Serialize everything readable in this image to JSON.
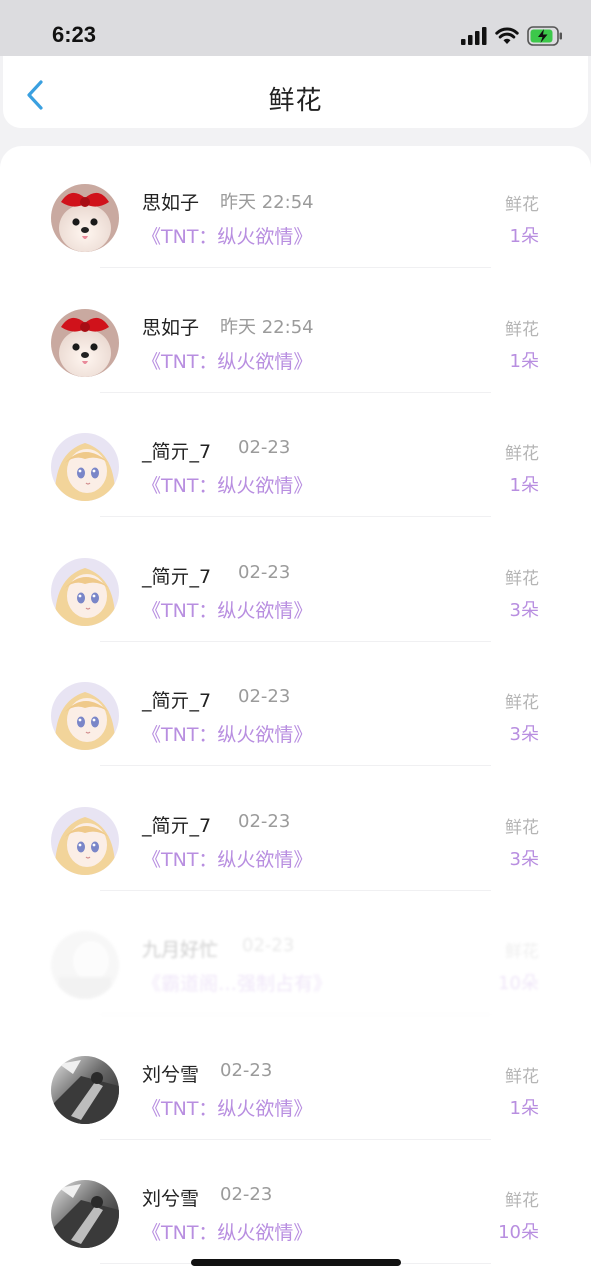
{
  "status": {
    "time": "6:23",
    "icons": [
      "signal-icon",
      "wifi-icon",
      "battery-charging-icon"
    ]
  },
  "header": {
    "back_icon": "chevron-left-icon",
    "title": "鲜花"
  },
  "colors": {
    "accent": "#b88ee0",
    "back": "#3aa0e0",
    "muted": "#9b9b9b"
  },
  "rows": [
    {
      "name": "思如子",
      "time": "昨天 22:54",
      "book": "《TNT：纵火欲情》",
      "gift_label": "鲜花",
      "gift_count": "1朵",
      "avatar": "dog-avatar"
    },
    {
      "name": "思如子",
      "time": "昨天 22:54",
      "book": "《TNT：纵火欲情》",
      "gift_label": "鲜花",
      "gift_count": "1朵",
      "avatar": "dog-avatar"
    },
    {
      "name": "_简亓_7",
      "time": "02-23",
      "book": "《TNT：纵火欲情》",
      "gift_label": "鲜花",
      "gift_count": "1朵",
      "avatar": "anime-girl-avatar"
    },
    {
      "name": "_简亓_7",
      "time": "02-23",
      "book": "《TNT：纵火欲情》",
      "gift_label": "鲜花",
      "gift_count": "3朵",
      "avatar": "anime-girl-avatar"
    },
    {
      "name": "_简亓_7",
      "time": "02-23",
      "book": "《TNT：纵火欲情》",
      "gift_label": "鲜花",
      "gift_count": "3朵",
      "avatar": "anime-girl-avatar"
    },
    {
      "name": "_简亓_7",
      "time": "02-23",
      "book": "《TNT：纵火欲情》",
      "gift_label": "鲜花",
      "gift_count": "3朵",
      "avatar": "anime-girl-avatar"
    },
    {
      "name": "九月好忙",
      "time": "02-23",
      "book": "《霸道阁…强制占有》",
      "gift_label": "鲜花",
      "gift_count": "10朵",
      "avatar": "blurred-avatar"
    },
    {
      "name": "刘兮雪",
      "time": "02-23",
      "book": "《TNT：纵火欲情》",
      "gift_label": "鲜花",
      "gift_count": "1朵",
      "avatar": "grayscale-photo-avatar"
    },
    {
      "name": "刘兮雪",
      "time": "02-23",
      "book": "《TNT：纵火欲情》",
      "gift_label": "鲜花",
      "gift_count": "10朵",
      "avatar": "grayscale-photo-avatar"
    }
  ]
}
